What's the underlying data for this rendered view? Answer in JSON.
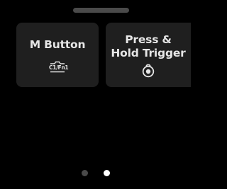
{
  "tiles": [
    {
      "label": "M Button",
      "icon": "c1-fn1-icon",
      "icon_text": "C1/Fn1"
    },
    {
      "label": "Press &\nHold Trigger",
      "icon": "camera-trigger-icon"
    }
  ],
  "pager": {
    "count": 2,
    "active_index": 1
  },
  "colors": {
    "background": "#000000",
    "tile": "#1f1f1f",
    "text": "#e6e6e6",
    "dot_inactive": "#4a4a4a",
    "dot_active": "#ffffff"
  }
}
